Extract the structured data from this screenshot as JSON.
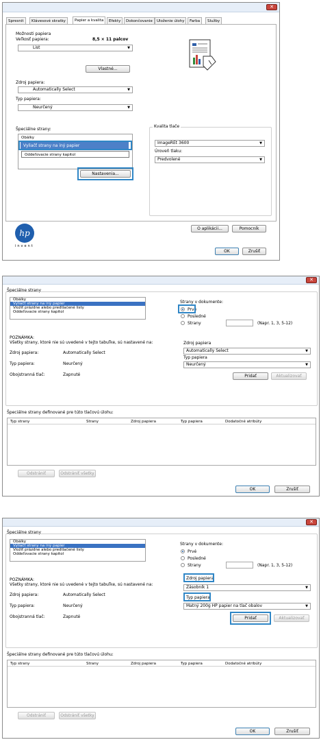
{
  "panel1": {
    "tabs": [
      "Spresnit",
      "Klávesové skratky",
      "Papier a kvalita",
      "Efekty",
      "Dokončovanie",
      "Uloženie úlohy",
      "Farba",
      "Služby"
    ],
    "active_tab_index": 2,
    "paper_options_title": "Možnosti papiera",
    "paper_size_label": "Veľkosť papiera:",
    "paper_size_value": "8,5 × 11 palcov",
    "paper_size_dropdown": "List",
    "custom_button": "Vlastné...",
    "paper_source_label": "Zdroj papiera:",
    "paper_source_value": "Automatically Select",
    "paper_type_label": "Typ papiera:",
    "paper_type_value": "Neurčený",
    "special_pages_label": "Špeciálne strany:",
    "special_pages_items": [
      "Obálky",
      "Vyliačť strany na iný papier",
      "Oddeľovacie strany kapitol"
    ],
    "special_pages_selected_index": 1,
    "settings_button": "Nastavenia...",
    "print_quality_title": "Kvalita tlače",
    "print_quality_value": "ImageREt 3600",
    "print_level_label": "Úroveň tlaku:",
    "print_level_value": "Predvolené",
    "brand_logo": "hp",
    "brand_tagline": "invent",
    "about_button": "O aplikácii...",
    "help_button": "Pomocník",
    "ok_button": "OK",
    "cancel_button": "Zrušiť"
  },
  "panel2": {
    "close_glyph": "✕",
    "section_title": "Špeciálne strany",
    "list_items": [
      "Obálky",
      "Vyliačť strany na iný papier",
      "Vložiť prázdne alebo predtlačené listy",
      "Oddeľovacie strany kapitol"
    ],
    "selected_index": 1,
    "pages_in_doc_label": "Strany v dokumente:",
    "radio_first": "Prvé",
    "radio_last": "Posledné",
    "radio_pages": "Strany",
    "radio_selected": "first",
    "pages_hint": "(Napr. 1, 3, 5-12)",
    "note_title": "POZNÁMKA:",
    "note_text": "Všetky strany, ktoré nie sú uvedené v tejto tabuľke, sú nastavené na:",
    "note_rows": [
      {
        "label": "Zdroj papiera:",
        "value": "Automatically Select"
      },
      {
        "label": "Typ papiera:",
        "value": "Neurčený"
      },
      {
        "label": "Obojstranná tlač:",
        "value": "Zapnuté"
      }
    ],
    "paper_source_label": "Zdroj papiera",
    "paper_source_value": "Automatically Select",
    "paper_type_label": "Typ papiera",
    "paper_type_value": "Neurčený",
    "add_button": "Pridať",
    "update_button": "Aktualizovať",
    "table_title": "Špeciálne strany definované pre túto tlačovú úlohu:",
    "table_headers": [
      "Typ strany",
      "Strany",
      "Zdroj papiera",
      "Typ papiera",
      "Dodatočné atribúty"
    ],
    "remove_button": "Odstrániť",
    "remove_all_button": "Odstrániť všetky",
    "ok_button": "OK",
    "cancel_button": "Zrušiť"
  },
  "panel3": {
    "close_glyph": "✕",
    "section_title": "Špeciálne strany",
    "list_items": [
      "Obálky",
      "Vyliačť strany na iný papier",
      "Vložiť prázdne alebo predtlačené listy",
      "Oddeľovacie strany kapitol"
    ],
    "selected_index": 1,
    "pages_in_doc_label": "Strany v dokumente:",
    "radio_first": "Prvé",
    "radio_last": "Posledné",
    "radio_pages": "Strany",
    "radio_selected": "first",
    "pages_hint": "(Napr. 1, 3, 5-12)",
    "note_title": "POZNÁMKA:",
    "note_text": "Všetky strany, ktoré nie sú uvedené v tejto tabuľke, sú nastavené na:",
    "note_rows": [
      {
        "label": "Zdroj papiera:",
        "value": "Automatically Select"
      },
      {
        "label": "Typ papiera:",
        "value": "Neurčený"
      },
      {
        "label": "Obojstranná tlač:",
        "value": "Zapnuté"
      }
    ],
    "paper_source_label": "Zdroj papiera",
    "paper_source_value": "Zásobník 1",
    "paper_type_label": "Typ papiera",
    "paper_type_value": "Matný 200g HP papier na tlač obalov",
    "add_button": "Pridať",
    "update_button": "Aktualizovať",
    "table_title": "Špeciálne strany definované pre túto tlačovú úlohu:",
    "table_headers": [
      "Typ strany",
      "Strany",
      "Zdroj papiera",
      "Typ papiera",
      "Dodatočné atribúty"
    ],
    "remove_button": "Odstrániť",
    "remove_all_button": "Odstrániť všetky",
    "ok_button": "OK",
    "cancel_button": "Zrušiť"
  },
  "colors": {
    "highlight": "#2f86c6",
    "selection": "#3a72c2",
    "close_button": "#c9463d"
  }
}
